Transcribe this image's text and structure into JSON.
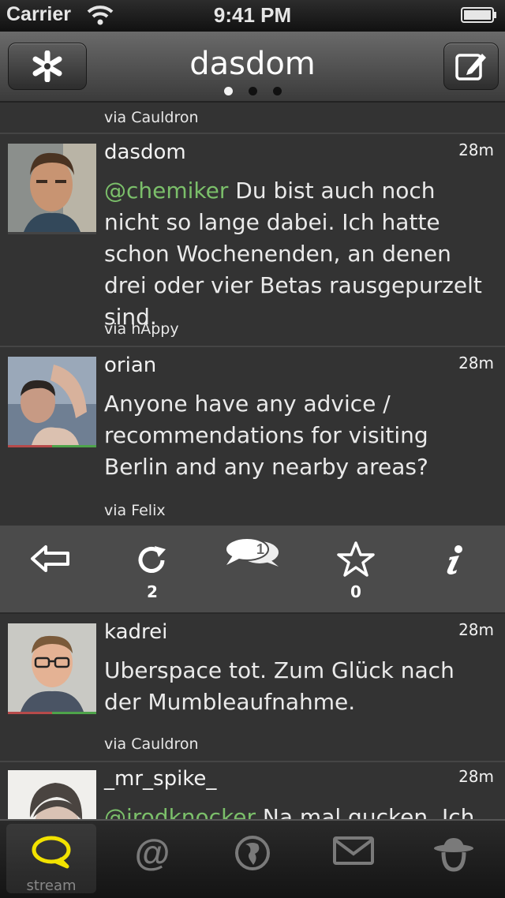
{
  "status_bar": {
    "carrier": "Carrier",
    "time": "9:41 PM"
  },
  "nav": {
    "title": "dasdom",
    "page_count": 3,
    "active_page": 1,
    "left_icon": "asterisk-icon",
    "right_icon": "compose-icon"
  },
  "partial_top": {
    "via": "via Cauldron"
  },
  "posts": [
    {
      "user": "dasdom",
      "time": "28m",
      "mention": "@chemiker",
      "text": " Du bist auch noch nicht so lange dabei. Ich hatte schon Wochenenden, an denen drei oder vier Betas rausgepurzelt sind.",
      "via": "via hAppy"
    },
    {
      "user": "orian",
      "time": "28m",
      "text": "Anyone have any advice / recommendations for visiting Berlin and any nearby areas?",
      "via": "via Felix"
    },
    {
      "user": "kadrei",
      "time": "28m",
      "text": "Uberspace tot. Zum Glück nach der Mumbleaufnahme.",
      "via": "via Cauldron"
    },
    {
      "user": "_mr_spike_",
      "time": "28m",
      "mention": "@irodknocker",
      "text": " Na mal gucken. Ich"
    }
  ],
  "actions": {
    "reply_icon": "reply-arrow-icon",
    "repost_icon": "repost-icon",
    "repost_count": "2",
    "conversation_icon": "conversation-icon",
    "conversation_count": "1",
    "star_icon": "star-icon",
    "star_count": "0",
    "info_icon": "info-icon"
  },
  "tabs": [
    {
      "label": "stream",
      "icon": "speech-bubble-icon",
      "active": true
    },
    {
      "label": "",
      "icon": "at-icon"
    },
    {
      "label": "",
      "icon": "globe-icon"
    },
    {
      "label": "",
      "icon": "mail-icon"
    },
    {
      "label": "",
      "icon": "incognito-hat-icon"
    }
  ],
  "colors": {
    "accent": "#7bbf6a",
    "active_tab": "#f2e200",
    "background": "#333333"
  }
}
